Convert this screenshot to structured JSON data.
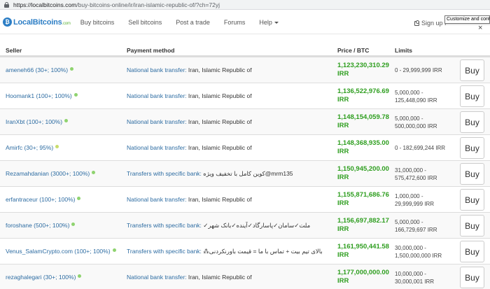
{
  "browser": {
    "url_host": "https://localbitcoins.com",
    "url_path": "/buy-bitcoins-online/ir/iran-islamic-republic-of/?ch=72yj"
  },
  "nav": {
    "logo": "LocalBitcoins",
    "logo_suffix": ".com",
    "items": [
      "Buy bitcoins",
      "Sell bitcoins",
      "Post a trade",
      "Forums",
      "Help"
    ],
    "signup": "Sign up f",
    "tooltip": "Customize and cont",
    "close_glyph": "×"
  },
  "table": {
    "headers": {
      "seller": "Seller",
      "payment": "Payment method",
      "price": "Price / BTC",
      "limits": "Limits"
    },
    "buy_label": "Buy",
    "rows": [
      {
        "seller": "ameneh66 (30+; 100%)",
        "status": "green",
        "method": "National bank transfer:",
        "detail": " Iran, Islamic Republic of",
        "price": "1,123,230,310.29",
        "currency": "IRR",
        "limit1": "0 - 29,999,999 IRR",
        "limit2": ""
      },
      {
        "seller": "Hoomank1 (100+; 100%)",
        "status": "green",
        "method": "National bank transfer:",
        "detail": " Iran, Islamic Republic of",
        "price": "1,136,522,976.69",
        "currency": "IRR",
        "limit1": "5,000,000 -",
        "limit2": "125,448,090 IRR"
      },
      {
        "seller": "IranXbt (100+; 100%)",
        "status": "green",
        "method": "National bank transfer:",
        "detail": " Iran, Islamic Republic of",
        "price": "1,148,154,059.78",
        "currency": "IRR",
        "limit1": "5,000,000 -",
        "limit2": "500,000,000 IRR"
      },
      {
        "seller": "Amirfc (30+; 95%)",
        "status": "yellow",
        "method": "National bank transfer:",
        "detail": " Iran, Islamic Republic of",
        "price": "1,148,368,935.00",
        "currency": "IRR",
        "limit1": "0 - 182,699,244 IRR",
        "limit2": ""
      },
      {
        "seller": "Rezamahdanian (3000+; 100%)",
        "status": "green",
        "method": "Transfers with specific bank:",
        "detail": " ‌کوین کامل با تخفیف ویژه@mrm135",
        "price": "1,150,945,200.00",
        "currency": "IRR",
        "limit1": "31,000,000 -",
        "limit2": "575,472,600 IRR"
      },
      {
        "seller": "erfantraceur (100+; 100%)",
        "status": "green",
        "method": "National bank transfer:",
        "detail": " Iran, Islamic Republic of",
        "price": "1,155,871,686.76",
        "currency": "IRR",
        "limit1": "1,000,000 -",
        "limit2": "29,999,999 IRR"
      },
      {
        "seller": "foroshane (500+; 100%)",
        "status": "green",
        "method": "Transfers with specific bank:",
        "detail": " ✓ملت✓سامان✓پاسارگاد✓آینده✓بانک شهر",
        "price": "1,156,697,882.17",
        "currency": "IRR",
        "limit1": "5,000,000 -",
        "limit2": "166,729,697 IRR"
      },
      {
        "seller": "Venus_SalamCrypto.com (100+; 100%)",
        "status": "green",
        "method": "Transfers with specific bank:",
        "detail": " ⁂بالای تیم بیت + تماس با ما = قیمت باورنکردنی",
        "price": "1,161,950,441.58",
        "currency": "IRR",
        "limit1": "30,000,000 -",
        "limit2": "1,500,000,000 IRR"
      },
      {
        "seller": "rezaghalegari (30+; 100%)",
        "status": "green",
        "method": "National bank transfer:",
        "detail": " Iran, Islamic Republic of",
        "price": "1,177,000,000.00",
        "currency": "IRR",
        "limit1": "10,000,000 -",
        "limit2": "30,000,001 IRR"
      }
    ]
  }
}
